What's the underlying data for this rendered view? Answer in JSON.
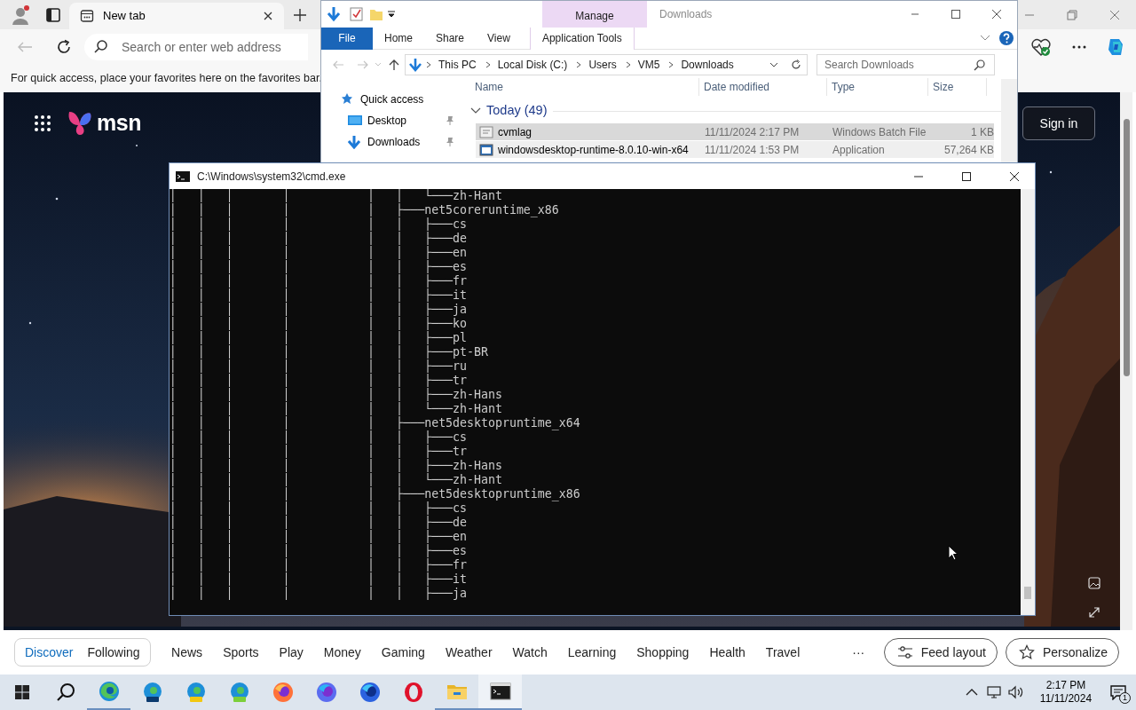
{
  "browser": {
    "tabs": [
      {
        "label": "New tab",
        "selected": true
      }
    ],
    "address_bar": {
      "placeholder": "Search or enter web address"
    },
    "favorites_message": "For quick access, place your favorites here on the favorites bar."
  },
  "msn": {
    "logo": "msn",
    "sign_in": "Sign in",
    "feed_tabs": [
      {
        "label": "Discover",
        "selected": true
      },
      {
        "label": "Following",
        "selected": false
      }
    ],
    "categories": [
      "News",
      "Sports",
      "Play",
      "Money",
      "Gaming",
      "Weather",
      "Watch",
      "Learning",
      "Shopping",
      "Health",
      "Travel"
    ],
    "more": "···",
    "feed_layout": "Feed layout",
    "personalize": "Personalize"
  },
  "explorer": {
    "title": "Downloads",
    "contextual_group": "Manage",
    "ribbon_tabs": [
      {
        "label": "File",
        "kind": "file"
      },
      {
        "label": "Home",
        "kind": "plain"
      },
      {
        "label": "Share",
        "kind": "plain"
      },
      {
        "label": "View",
        "kind": "plain"
      },
      {
        "label": "Application Tools",
        "kind": "contextual"
      }
    ],
    "breadcrumb": [
      "This PC",
      "Local Disk (C:)",
      "Users",
      "VM5",
      "Downloads"
    ],
    "search": {
      "placeholder": "Search Downloads"
    },
    "nav": [
      {
        "label": "Quick access",
        "kind": "star",
        "pinned": false
      },
      {
        "label": "Desktop",
        "kind": "desktop",
        "pinned": true
      },
      {
        "label": "Downloads",
        "kind": "download",
        "pinned": true
      }
    ],
    "columns": [
      "Name",
      "Date modified",
      "Type",
      "Size"
    ],
    "group": "Today (49)",
    "files": [
      {
        "name": "cvmlag",
        "date": "11/11/2024 2:17 PM",
        "type": "Windows Batch File",
        "size": "1 KB",
        "kind": "batch",
        "selected": true
      },
      {
        "name": "windowsdesktop-runtime-8.0.10-win-x64",
        "date": "11/11/2024 1:53 PM",
        "type": "Application",
        "size": "57,264 KB",
        "kind": "app",
        "selected": false
      }
    ]
  },
  "console": {
    "title": "C:\\Windows\\system32\\cmd.exe",
    "lines": [
      "│   │   │       │           │   │   └───zh-Hant",
      "│   │   │       │           │   ├───net5coreruntime_x86",
      "│   │   │       │           │   │   ├───cs",
      "│   │   │       │           │   │   ├───de",
      "│   │   │       │           │   │   ├───en",
      "│   │   │       │           │   │   ├───es",
      "│   │   │       │           │   │   ├───fr",
      "│   │   │       │           │   │   ├───it",
      "│   │   │       │           │   │   ├───ja",
      "│   │   │       │           │   │   ├───ko",
      "│   │   │       │           │   │   ├───pl",
      "│   │   │       │           │   │   ├───pt-BR",
      "│   │   │       │           │   │   ├───ru",
      "│   │   │       │           │   │   ├───tr",
      "│   │   │       │           │   │   ├───zh-Hans",
      "│   │   │       │           │   │   └───zh-Hant",
      "│   │   │       │           │   ├───net5desktopruntime_x64",
      "│   │   │       │           │   │   ├───cs",
      "│   │   │       │           │   │   ├───tr",
      "│   │   │       │           │   │   ├───zh-Hans",
      "│   │   │       │           │   │   └───zh-Hant",
      "│   │   │       │           │   ├───net5desktopruntime_x86",
      "│   │   │       │           │   │   ├───cs",
      "│   │   │       │           │   │   ├───de",
      "│   │   │       │           │   │   ├───en",
      "│   │   │       │           │   │   ├───es",
      "│   │   │       │           │   │   ├───fr",
      "│   │   │       │           │   │   ├───it",
      "│   │   │       │           │   │   ├───ja"
    ]
  },
  "taskbar": {
    "apps": [
      {
        "kind": "edge",
        "running": true,
        "selected": false
      },
      {
        "kind": "edge_beta",
        "running": false,
        "selected": false
      },
      {
        "kind": "edge_canary",
        "running": false,
        "selected": false
      },
      {
        "kind": "edge_dev",
        "running": false,
        "selected": false
      },
      {
        "kind": "firefox",
        "running": false,
        "selected": false
      },
      {
        "kind": "firefox_dev",
        "running": false,
        "selected": false
      },
      {
        "kind": "firefox_nightly",
        "running": false,
        "selected": false
      },
      {
        "kind": "opera",
        "running": false,
        "selected": false
      },
      {
        "kind": "explorer",
        "running": true,
        "selected": false
      },
      {
        "kind": "cmd",
        "running": true,
        "selected": true
      }
    ],
    "time": "2:17 PM",
    "date": "11/11/2024",
    "notifications": "1"
  }
}
